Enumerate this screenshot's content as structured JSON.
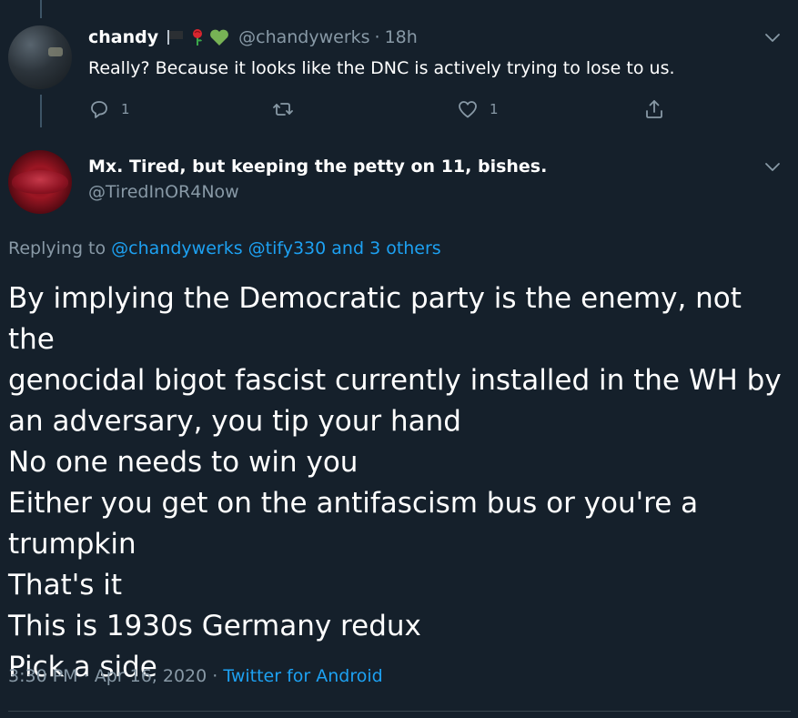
{
  "parent_tweet": {
    "display_name": "chandy",
    "emojis": [
      "flag-icon",
      "rose-icon",
      "green-heart-icon"
    ],
    "handle": "@chandywerks",
    "separator": "·",
    "time": "18h",
    "text": "Really? Because it looks like the DNC is actively trying to lose to us.",
    "reply_count": "1",
    "retweet_count": "",
    "like_count": "1"
  },
  "main_tweet": {
    "display_name": "Mx. Tired, but keeping the petty on 11, bishes.",
    "handle": "@TiredInOR4Now",
    "replying_prefix": "Replying to",
    "replying_to": [
      "@chandywerks",
      "@tify330"
    ],
    "replying_others": "and 3 others",
    "body_lines": [
      "By implying the Democratic party is the enemy, not the",
      "genocidal bigot fascist currently installed in the WH by",
      "an adversary, you tip your hand",
      "No one needs to win you",
      "Either you get on the antifascism bus or you're a",
      "trumpkin",
      "That's it",
      "This is 1930s Germany redux",
      "Pick a side"
    ],
    "timestamp": "3:30 PM",
    "date": "Apr 16, 2020",
    "separator": "·",
    "source": "Twitter for Android"
  },
  "colors": {
    "background": "#15202b",
    "secondary_text": "#8899a6",
    "link": "#1da1f2",
    "divider": "#38444d"
  }
}
